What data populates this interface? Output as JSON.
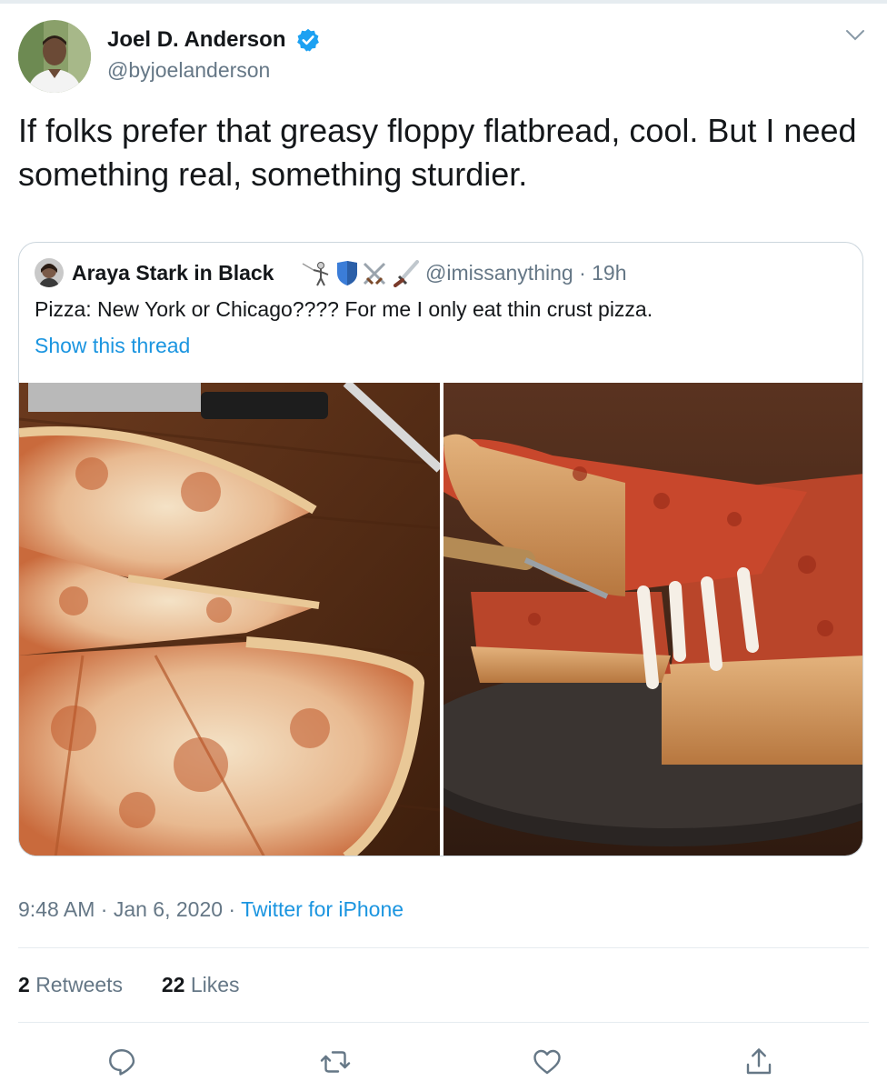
{
  "tweet": {
    "author_name": "Joel D. Anderson",
    "author_handle": "@byjoelanderson",
    "verified": true,
    "text": "If folks prefer that greasy floppy flatbread, cool. But I need something real, something sturdier.",
    "timestamp": "9:48 AM · Jan 6, 2020",
    "separator": " · ",
    "source": "Twitter for iPhone",
    "retweets_count": "2",
    "retweets_label": "Retweets",
    "likes_count": "22",
    "likes_label": "Likes"
  },
  "quoted_tweet": {
    "author_name": "Araya Stark in Black",
    "author_handle": "@imissanything",
    "time_ago": "19h",
    "dot": " · ",
    "emoji_icons": [
      "fencer-icon",
      "shield-icon",
      "crossed-swords-icon",
      "dagger-icon"
    ],
    "text": "Pizza: New York or Chicago???? For me I only eat thin crust pizza.",
    "show_thread_label": "Show this thread",
    "images": [
      "thin-crust-pizza-photo",
      "deep-dish-pizza-photo"
    ]
  },
  "actions": [
    "reply-icon",
    "retweet-icon",
    "like-icon",
    "share-icon"
  ],
  "colors": {
    "link": "#1b95e0",
    "secondary_text": "#657786",
    "primary_text": "#14171a",
    "border": "#ccd6dd",
    "verified": "#1da1f2"
  }
}
